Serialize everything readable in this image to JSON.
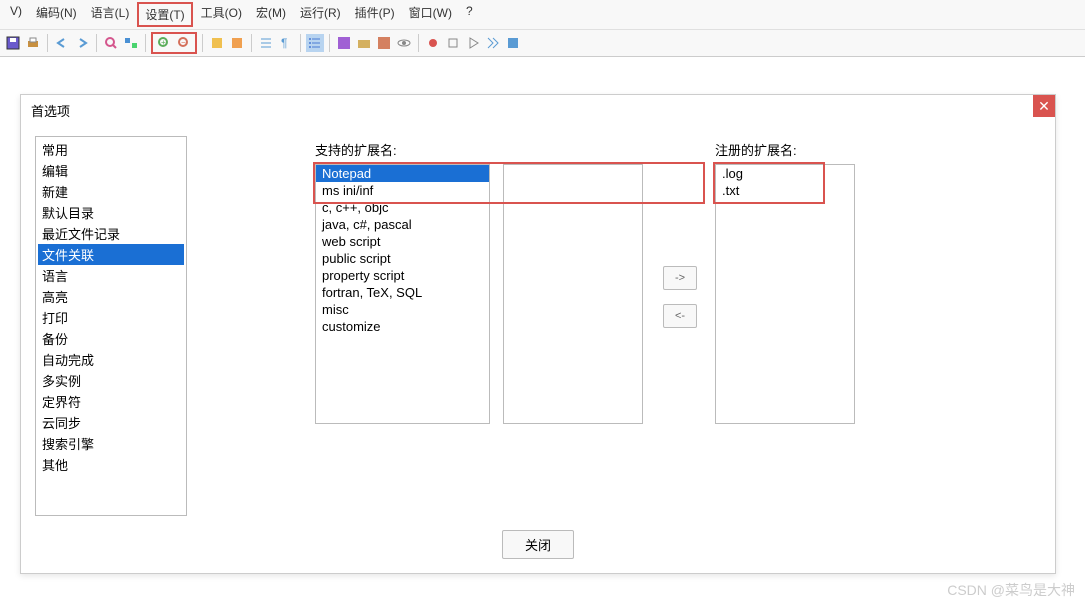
{
  "menu": {
    "items": [
      "V)",
      "编码(N)",
      "语言(L)",
      "设置(T)",
      "工具(O)",
      "宏(M)",
      "运行(R)",
      "插件(P)",
      "窗口(W)",
      "?"
    ],
    "highlighted_index": 3
  },
  "dialog": {
    "title": "首选项",
    "close_button": "关闭",
    "categories": [
      "常用",
      "编辑",
      "新建",
      "默认目录",
      "最近文件记录",
      "文件关联",
      "语言",
      "高亮",
      "打印",
      "备份",
      "自动完成",
      "多实例",
      "定界符",
      "云同步",
      "搜索引擎",
      "其他"
    ],
    "selected_category_index": 5,
    "supported_label": "支持的扩展名:",
    "registered_label": "注册的扩展名:",
    "supported_list": [
      "Notepad",
      "ms ini/inf",
      "c, c++, objc",
      "java, c#, pascal",
      "web script",
      "public script",
      "property script",
      "fortran, TeX, SQL",
      "misc",
      "customize"
    ],
    "supported_selected_index": 0,
    "middle_list": [],
    "registered_list": [
      ".log",
      ".txt"
    ],
    "arrow_right": "->",
    "arrow_left": "<-"
  },
  "watermark": "CSDN @菜鸟是大神"
}
